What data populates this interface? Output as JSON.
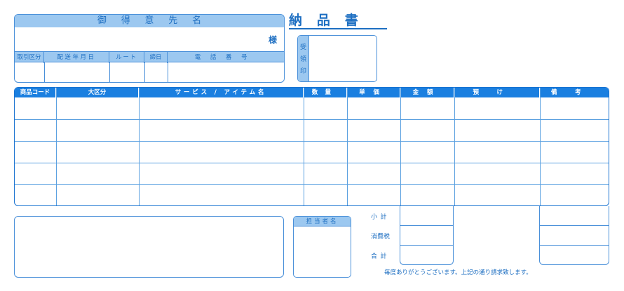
{
  "customer": {
    "header": "御得意先名",
    "suffix": "様",
    "columns": [
      "取引区分",
      "配送年月日",
      "ルート",
      "締日",
      "電話番号"
    ]
  },
  "title": "納品書",
  "receipt_stamp": {
    "label": [
      "受",
      "領",
      "印"
    ]
  },
  "table": {
    "columns": [
      "商品コード",
      "大区分",
      "サービス / アイテム名",
      "数量",
      "単価",
      "金額",
      "預け",
      "備考"
    ],
    "row_count": 5
  },
  "staff": {
    "header": "担当者名"
  },
  "totals": {
    "subtotal": "小計",
    "tax": "消費税",
    "total": "合計"
  },
  "footer": {
    "thanks": "毎度ありがとうございます。上記の通り請求致します。"
  },
  "colors": {
    "accent": "#1a7fe0",
    "light": "#9cc8f0",
    "line": "#4a90d9"
  }
}
